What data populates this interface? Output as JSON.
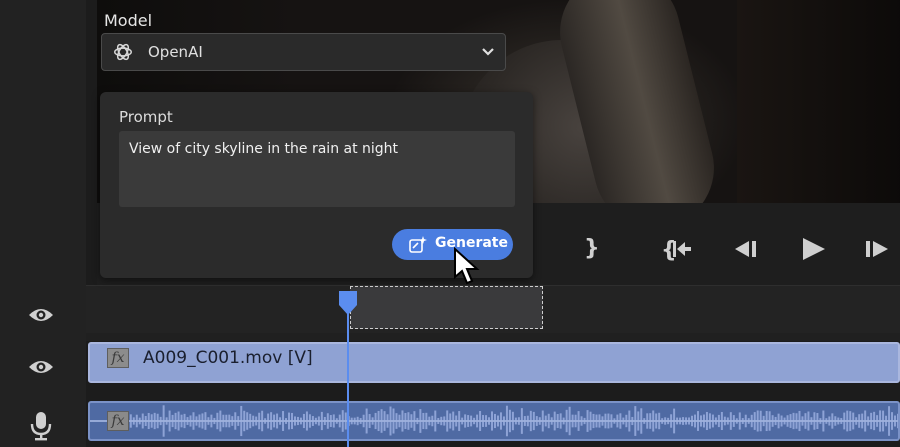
{
  "model": {
    "label": "Model",
    "selected": "OpenAI",
    "icon": "openai-logo-icon"
  },
  "prompt": {
    "label": "Prompt",
    "value": "View of city skyline in the rain at night"
  },
  "generate_button": {
    "label": "Generate",
    "icon": "generate-sparkle-icon"
  },
  "transport": {
    "mark_out": "}",
    "go_to_in": "{⇤",
    "step_back": "◀I",
    "play": "▶",
    "step_forward": "I▶"
  },
  "timeline": {
    "video_clip": {
      "fx": "fx",
      "name": "A009_C001.mov [V]"
    },
    "audio_clip": {
      "fx": "fx"
    }
  },
  "colors": {
    "accent": "#4a7de0",
    "video_clip": "#8fa2d3",
    "audio_clip": "#4f6aa3",
    "playhead": "#5b8def"
  }
}
